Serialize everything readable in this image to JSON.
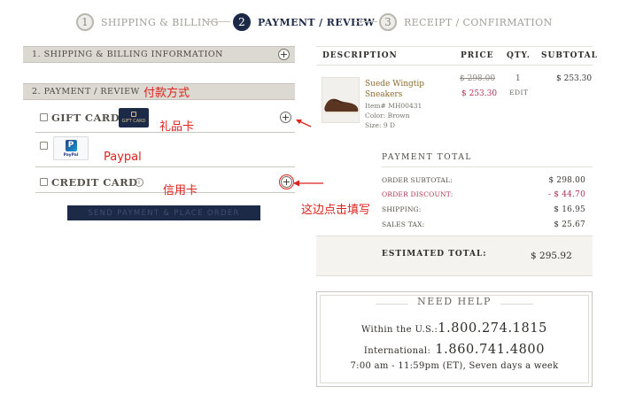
{
  "steps": [
    {
      "number": "1",
      "label": "SHIPPING & BILLING",
      "active": false
    },
    {
      "number": "2",
      "label": "PAYMENT / REVIEW",
      "active": true
    },
    {
      "number": "3",
      "label": "RECEIPT / CONFIRMATION",
      "active": false
    }
  ],
  "sections": {
    "shipping_billing": "1. SHIPPING & BILLING INFORMATION",
    "payment_review": "2. PAYMENT / REVIEW"
  },
  "payment_options": {
    "gift_card_label": "GIFT CARD",
    "gift_card_image_text": "GIFT CARD",
    "paypal_logo_text": "PayPal",
    "credit_card_label": "CREDIT CARD",
    "info_icon_glyph": "i"
  },
  "send_button": "SEND PAYMENT & PLACE ORDER",
  "annotations": {
    "payment_method": "付款方式",
    "gift_card": "礼品卡",
    "paypal": "Paypal",
    "credit_card": "信用卡",
    "click_here": "这边点击填写",
    "color": "#e0211b"
  },
  "cart": {
    "headers": {
      "description": "DESCRIPTION",
      "price": "PRICE",
      "qty": "QTY.",
      "subtotal": "SUBTOTAL"
    },
    "item": {
      "name": "Suede Wingtip Sneakers",
      "item_number": "Item# MH00431",
      "color": "Color: Brown",
      "size": "Size: 9 D",
      "original_price": "$ 298.00",
      "sale_price": "$ 253.30",
      "qty": "1",
      "edit": "EDIT",
      "subtotal": "$ 253.30"
    }
  },
  "payment_total": {
    "title": "PAYMENT TOTAL",
    "rows": [
      {
        "label": "ORDER SUBTOTAL:",
        "value": "$ 298.00"
      },
      {
        "label": "ORDER DISCOUNT:",
        "value": "- $ 44.70"
      },
      {
        "label": "SHIPPING:",
        "value": "$ 16.95"
      },
      {
        "label": "SALES TAX:",
        "value": "$ 25.67"
      }
    ],
    "estimated_label": "ESTIMATED TOTAL:",
    "estimated_value": "$ 295.92"
  },
  "help": {
    "title": "NEED HELP",
    "us_label": "Within the U.S.:",
    "us_phone": "1.800.274.1815",
    "intl_label": "International:",
    "intl_phone": "1.860.741.4800",
    "hours": "7:00 am - 11:59pm (ET), Seven days a week"
  },
  "colors": {
    "navy": "#1c2947",
    "discount": "#b03255",
    "section_bar": "#dcd9d2"
  },
  "icons": [
    "plus-circle-icon",
    "info-icon",
    "red-arrow-icon",
    "paypal-logo",
    "gift-card-image",
    "shoe-thumbnail"
  ]
}
